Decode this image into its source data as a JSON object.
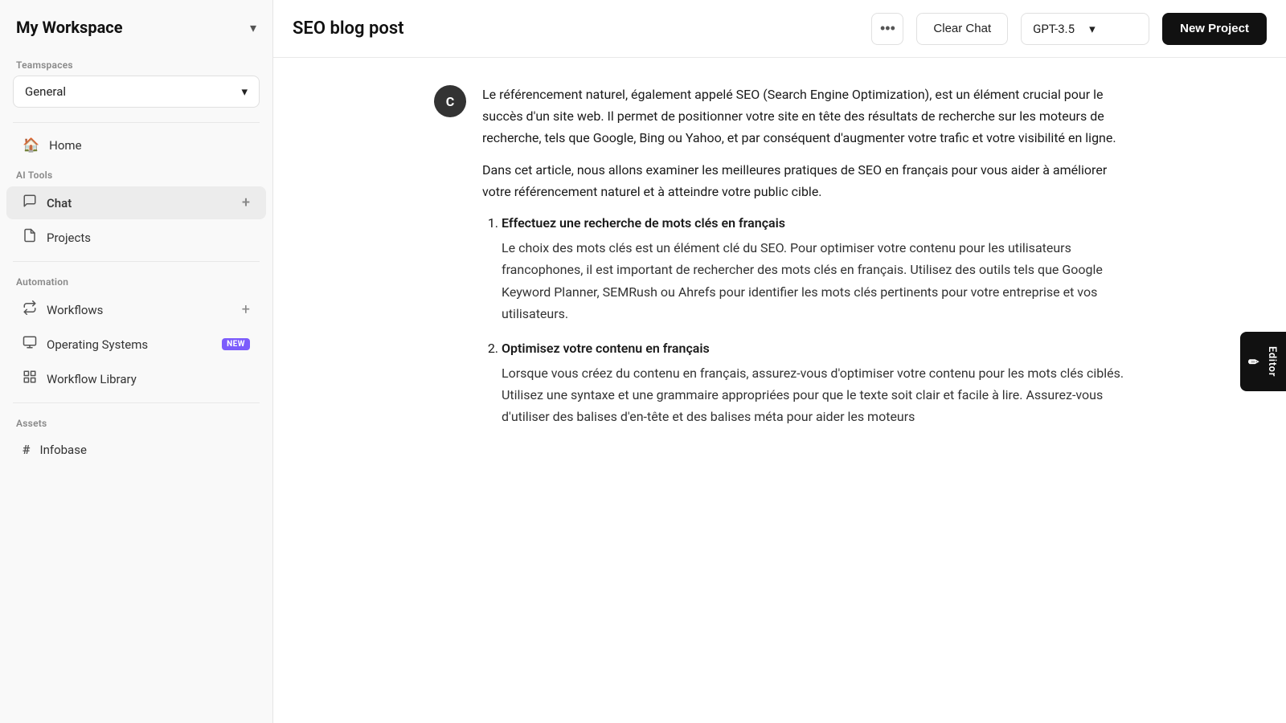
{
  "sidebar": {
    "workspace_title": "My Workspace",
    "workspace_chevron": "▾",
    "teamspaces_label": "Teamspaces",
    "teamspace_selected": "General",
    "teamspace_chevron": "▾",
    "ai_tools_label": "AI Tools",
    "nav_items": [
      {
        "id": "home",
        "icon": "🏠",
        "label": "Home",
        "active": false
      },
      {
        "id": "chat",
        "icon": "💬",
        "label": "Chat",
        "active": true,
        "has_add": true
      },
      {
        "id": "projects",
        "icon": "📋",
        "label": "Projects",
        "active": false
      }
    ],
    "automation_label": "Automation",
    "automation_items": [
      {
        "id": "workflows",
        "icon": "⟳",
        "label": "Workflows",
        "has_add": true
      },
      {
        "id": "operating-systems",
        "icon": "🖥",
        "label": "Operating Systems",
        "badge": "NEW"
      },
      {
        "id": "workflow-library",
        "icon": "⊞",
        "label": "Workflow Library"
      }
    ],
    "assets_label": "Assets",
    "assets_items": [
      {
        "id": "infobase",
        "icon": "#",
        "label": "Infobase"
      }
    ]
  },
  "header": {
    "title": "SEO blog post",
    "dots_label": "•••",
    "clear_chat_label": "Clear Chat",
    "model_label": "GPT-3.5",
    "model_chevron": "▾",
    "new_project_label": "New Project"
  },
  "chat": {
    "avatar_letter": "C",
    "message_para1": "Le référencement naturel, également appelé SEO (Search Engine Optimization), est un élément crucial pour le succès d'un site web. Il permet de positionner votre site en tête des résultats de recherche sur les moteurs de recherche, tels que Google, Bing ou Yahoo, et par conséquent d'augmenter votre trafic et votre visibilité en ligne.",
    "message_para2": "Dans cet article, nous allons examiner les meilleures pratiques de SEO en français pour vous aider à améliorer votre référencement naturel et à atteindre votre public cible.",
    "list_items": [
      {
        "title": "Effectuez une recherche de mots clés en français",
        "body": "Le choix des mots clés est un élément clé du SEO. Pour optimiser votre contenu pour les utilisateurs francophones, il est important de rechercher des mots clés en français. Utilisez des outils tels que Google Keyword Planner, SEMRush ou Ahrefs pour identifier les mots clés pertinents pour votre entreprise et vos utilisateurs."
      },
      {
        "title": "Optimisez votre contenu en français",
        "body": "Lorsque vous créez du contenu en français, assurez-vous d'optimiser votre contenu pour les mots clés ciblés. Utilisez une syntaxe et une grammaire appropriées pour que le texte soit clair et facile à lire. Assurez-vous d'utiliser des balises d'en-tête et des balises méta pour aider les moteurs"
      }
    ]
  },
  "editor_tab": {
    "label": "Editor",
    "icon": "✏"
  }
}
